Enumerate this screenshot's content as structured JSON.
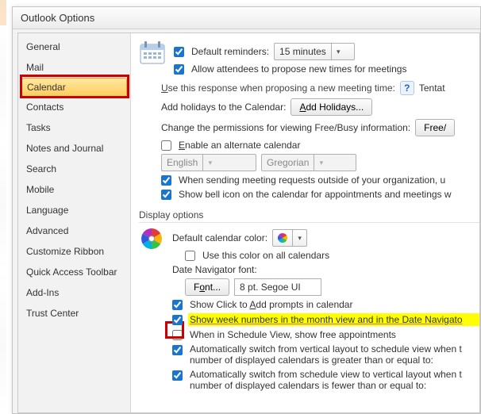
{
  "dialog_title": "Outlook Options",
  "sidebar": [
    "General",
    "Mail",
    "Calendar",
    "Contacts",
    "Tasks",
    "Notes and Journal",
    "Search",
    "Mobile",
    "Language",
    "Advanced",
    "Customize Ribbon",
    "Quick Access Toolbar",
    "Add-Ins",
    "Trust Center"
  ],
  "selected_sidebar": "Calendar",
  "cal": {
    "default_reminders_label": "Default reminders:",
    "default_reminders_value": "15 minutes",
    "allow_propose": "Allow attendees to propose new times for meetings",
    "use_response": "Use this response when proposing a new meeting time:",
    "use_response_value": "Tentat",
    "add_holidays_label": "Add holidays to the Calendar:",
    "add_holidays_btn": "Add Holidays...",
    "change_perms": "Change the permissions for viewing Free/Busy information:",
    "freebusy_btn": "Free/",
    "enable_alt": "Enable an alternate calendar",
    "alt_lang": "English",
    "alt_cal": "Gregorian",
    "when_sending": "When sending meeting requests outside of your organization, u",
    "show_bell": "Show bell icon on the calendar for appointments and meetings w"
  },
  "disp": {
    "header": "Display options",
    "default_color": "Default calendar color:",
    "use_color_all": "Use this color on all calendars",
    "navigator_font": "Date Navigator font:",
    "font_btn": "Font...",
    "font_value": "8 pt. Segoe UI",
    "show_click": "Show Click to Add prompts in calendar",
    "week_numbers": "Show week numbers in the month view and in the Date Navigato",
    "schedule_free": "When in Schedule View, show free appointments",
    "auto_switch_1a": "Automatically switch from vertical layout to schedule view when t",
    "auto_switch_1b": "number of displayed calendars is greater than or equal to:",
    "auto_switch_2a": "Automatically switch from schedule view to vertical layout when t",
    "auto_switch_2b": "number of displayed calendars is fewer than or equal to:"
  },
  "colors": {
    "accent": "#1a75d1"
  }
}
